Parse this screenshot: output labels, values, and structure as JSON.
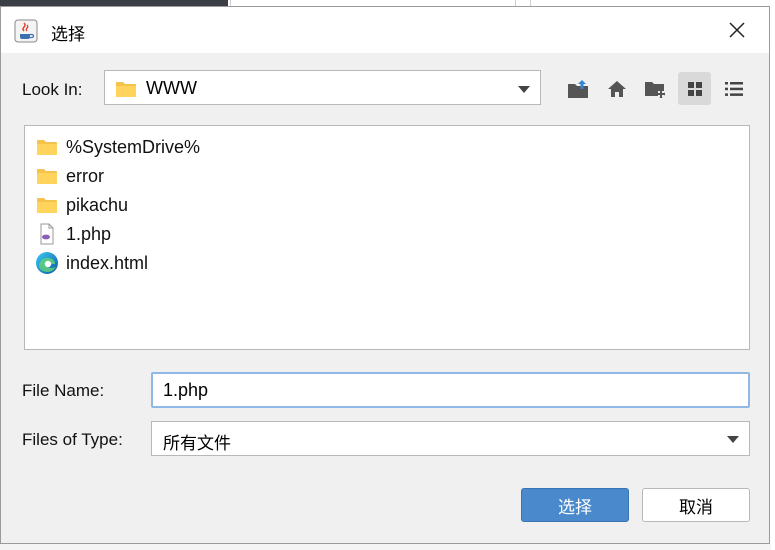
{
  "window": {
    "title": "选择",
    "title_icon": "java-cup-icon",
    "close_icon": "close-icon"
  },
  "look_in": {
    "label": "Look In:",
    "value": "WWW",
    "value_icon": "folder-icon"
  },
  "toolbar": [
    {
      "name": "up-one-level-button",
      "icon": "folder-up-icon"
    },
    {
      "name": "home-button",
      "icon": "home-icon"
    },
    {
      "name": "new-folder-button",
      "icon": "new-folder-icon"
    },
    {
      "name": "list-view-button",
      "icon": "grid-view-icon",
      "active": true
    },
    {
      "name": "details-view-button",
      "icon": "details-list-icon",
      "active": false
    }
  ],
  "files": [
    {
      "name": "%SystemDrive%",
      "icon": "folder-icon"
    },
    {
      "name": "error",
      "icon": "folder-icon"
    },
    {
      "name": "pikachu",
      "icon": "folder-icon"
    },
    {
      "name": "1.php",
      "icon": "php-file-icon"
    },
    {
      "name": "index.html",
      "icon": "edge-browser-icon"
    }
  ],
  "file_name": {
    "label": "File Name:",
    "value": "1.php"
  },
  "file_type": {
    "label": "Files of Type:",
    "value": "所有文件"
  },
  "buttons": {
    "approve": "选择",
    "cancel": "取消"
  },
  "colors": {
    "primary_button": "#4a89cc",
    "focus_border": "#8fb8e6",
    "folder": "#f5c24c",
    "dialog_bg": "#f0f0f0"
  }
}
